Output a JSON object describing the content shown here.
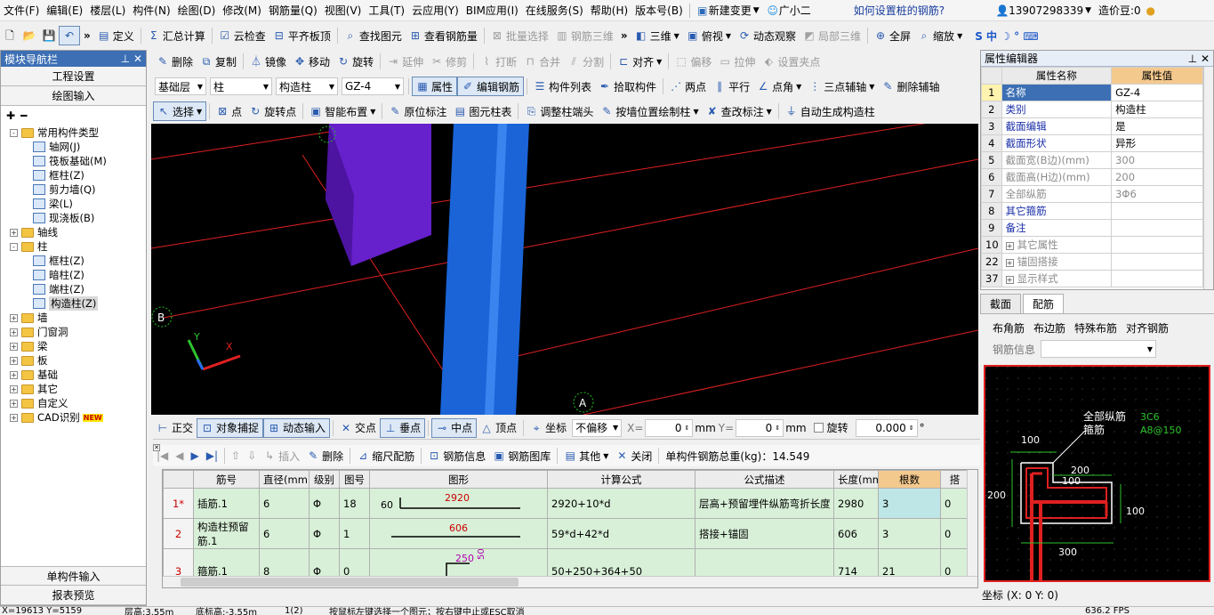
{
  "menu": {
    "items": [
      "文件(F)",
      "编辑(E)",
      "楼层(L)",
      "构件(N)",
      "绘图(D)",
      "修改(M)",
      "钢筋量(Q)",
      "视图(V)",
      "工具(T)",
      "云应用(Y)",
      "BIM应用(I)",
      "在线服务(S)",
      "帮助(H)",
      "版本号(B)"
    ],
    "new_change": "新建变更",
    "guangxiaoer": "广小二",
    "question": "如何设置桩的钢筋?",
    "phone": "13907298339",
    "coins": "造价豆:0"
  },
  "toolbar1": {
    "items": [
      "定义",
      "汇总计算",
      "云检查",
      "平齐板顶",
      "查找图元",
      "查看钢筋量",
      "批量选择",
      "钢筋三维"
    ],
    "right_items": [
      "三维",
      "俯视",
      "动态观察",
      "局部三维",
      "全屏",
      "缩放"
    ]
  },
  "toolbar2": {
    "items": [
      "删除",
      "复制",
      "镜像",
      "移动",
      "旋转",
      "延伸",
      "修剪",
      "打断",
      "合并",
      "分割",
      "对齐",
      "偏移",
      "拉伸",
      "设置夹点"
    ]
  },
  "toolbar3": {
    "floor": "基础层",
    "category": "柱",
    "type": "构造柱",
    "name": "GZ-4",
    "items": [
      "属性",
      "编辑钢筋",
      "构件列表",
      "拾取构件",
      "两点",
      "平行",
      "点角",
      "三点辅轴",
      "删除辅轴"
    ]
  },
  "toolbar4": {
    "items": [
      "选择",
      "点",
      "旋转点",
      "智能布置",
      "原位标注",
      "图元柱表",
      "调整柱端头",
      "按墙位置绘制柱",
      "查改标注",
      "自动生成构造柱"
    ]
  },
  "nav": {
    "title": "模块导航栏",
    "project_settings": "工程设置",
    "drawing_input": "绘图输入",
    "single_input": "单构件输入",
    "report_preview": "报表预览",
    "tree": [
      {
        "level": 0,
        "exp": "-",
        "icon": "folder",
        "label": "常用构件类型"
      },
      {
        "level": 1,
        "icon": "comp",
        "label": "轴网(J)"
      },
      {
        "level": 1,
        "icon": "comp",
        "label": "筏板基础(M)"
      },
      {
        "level": 1,
        "icon": "comp",
        "label": "框柱(Z)"
      },
      {
        "level": 1,
        "icon": "comp",
        "label": "剪力墙(Q)"
      },
      {
        "level": 1,
        "icon": "comp",
        "label": "梁(L)"
      },
      {
        "level": 1,
        "icon": "comp",
        "label": "现浇板(B)"
      },
      {
        "level": 0,
        "exp": "+",
        "icon": "folder",
        "label": "轴线"
      },
      {
        "level": 0,
        "exp": "-",
        "icon": "folder",
        "label": "柱"
      },
      {
        "level": 1,
        "icon": "comp",
        "label": "框柱(Z)"
      },
      {
        "level": 1,
        "icon": "comp",
        "label": "暗柱(Z)"
      },
      {
        "level": 1,
        "icon": "comp",
        "label": "端柱(Z)"
      },
      {
        "level": 1,
        "icon": "comp",
        "label": "构造柱(Z)",
        "selected": true
      },
      {
        "level": 0,
        "exp": "+",
        "icon": "folder",
        "label": "墙"
      },
      {
        "level": 0,
        "exp": "+",
        "icon": "folder",
        "label": "门窗洞"
      },
      {
        "level": 0,
        "exp": "+",
        "icon": "folder",
        "label": "梁"
      },
      {
        "level": 0,
        "exp": "+",
        "icon": "folder",
        "label": "板"
      },
      {
        "level": 0,
        "exp": "+",
        "icon": "folder",
        "label": "基础"
      },
      {
        "level": 0,
        "exp": "+",
        "icon": "folder",
        "label": "其它"
      },
      {
        "level": 0,
        "exp": "+",
        "icon": "folder",
        "label": "自定义"
      },
      {
        "level": 0,
        "exp": "+",
        "icon": "folder",
        "label": "CAD识别",
        "badge": "NEW"
      }
    ]
  },
  "viewport": {
    "axis_b": "B",
    "axis_a": "A",
    "axis_y": "Y",
    "axis_x": "X"
  },
  "snapbar": {
    "items": [
      "正交",
      "对象捕捉",
      "动态输入",
      "交点",
      "垂点",
      "中点",
      "顶点",
      "坐标"
    ],
    "offset_mode": "不偏移",
    "x_label": "X=",
    "x_value": "0",
    "y_label": "Y=",
    "y_value": "0",
    "unit": "mm",
    "rotate_label": "旋转",
    "rotate_value": "0.000",
    "degree": "°"
  },
  "rebarbar": {
    "items": [
      "插入",
      "删除",
      "缩尺配筋",
      "钢筋信息",
      "钢筋图库",
      "其他",
      "关闭"
    ],
    "total": "单构件钢筋总重(kg)：14.549"
  },
  "rebar_table": {
    "headers": [
      "",
      "筋号",
      "直径(mm)",
      "级别",
      "图号",
      "图形",
      "计算公式",
      "公式描述",
      "长度(mm)",
      "根数",
      "搭"
    ],
    "rows": [
      {
        "no": "1*",
        "name": "插筋.1",
        "dia": "6",
        "grade": "Φ",
        "fig": "18",
        "left": "60",
        "shape": "2920",
        "formula": "2920+10*d",
        "desc": "层高+预留埋件纵筋弯折长度",
        "len": "2980",
        "count": "3",
        "lap": "0"
      },
      {
        "no": "2",
        "name": "构造柱预留筋.1",
        "dia": "6",
        "grade": "Φ",
        "fig": "1",
        "left": "",
        "shape": "606",
        "formula": "59*d+42*d",
        "desc": "搭接+锚固",
        "len": "606",
        "count": "3",
        "lap": "0"
      },
      {
        "no": "3",
        "name": "箍筋.1",
        "dia": "8",
        "grade": "Φ",
        "fig": "0",
        "left": "",
        "shape": "250",
        "shape2": "50",
        "shape3": "364",
        "formula": "50+250+364+50",
        "desc": "",
        "len": "714",
        "count": "21",
        "lap": "0"
      }
    ]
  },
  "prop": {
    "title": "属性编辑器",
    "col_name": "属性名称",
    "col_value": "属性值",
    "rows": [
      {
        "n": "1",
        "name": "名称",
        "value": "GZ-4",
        "style": "blue",
        "sel": true
      },
      {
        "n": "2",
        "name": "类别",
        "value": "构造柱",
        "style": "blue"
      },
      {
        "n": "3",
        "name": "截面编辑",
        "value": "是",
        "style": "blue"
      },
      {
        "n": "4",
        "name": "截面形状",
        "value": "异形",
        "style": "blue"
      },
      {
        "n": "5",
        "name": "截面宽(B边)(mm)",
        "value": "300",
        "style": "grey"
      },
      {
        "n": "6",
        "name": "截面高(H边)(mm)",
        "value": "200",
        "style": "grey"
      },
      {
        "n": "7",
        "name": "全部纵筋",
        "value": "3Φ6",
        "style": "grey"
      },
      {
        "n": "8",
        "name": "其它箍筋",
        "value": "",
        "style": "blue"
      },
      {
        "n": "9",
        "name": "备注",
        "value": "",
        "style": "blue"
      },
      {
        "n": "10",
        "name": "其它属性",
        "value": "",
        "style": "grey",
        "exp": "+"
      },
      {
        "n": "22",
        "name": "锚固搭接",
        "value": "",
        "style": "grey",
        "exp": "+"
      },
      {
        "n": "37",
        "name": "显示样式",
        "value": "",
        "style": "grey",
        "exp": "+"
      }
    ]
  },
  "section": {
    "tab_section": "截面",
    "tab_rebar": "配筋",
    "buttons": [
      "布角筋",
      "布边筋",
      "特殊布筋",
      "对齐钢筋"
    ],
    "rebar_info": "钢筋信息",
    "label_all": "全部纵筋",
    "label_stirrup": "箍筋",
    "val_all": "3C6",
    "val_stirrup": "A8@150",
    "dim_100a": "100",
    "dim_200a": "200",
    "dim_100b": "100",
    "dim_200b": "200",
    "dim_100c": "100",
    "dim_300": "300",
    "coord": "坐标 (X: 0 Y: 0)"
  },
  "status": {
    "left": "X=19613 Y=5159",
    "floor_h": "层高:3.55m",
    "bottom_h": "底标高:-3.55m",
    "page": "1(2)",
    "hint": "按鼠标左键选择一个图元；按右键中止或ESC取消",
    "fps": "636.2 FPS"
  }
}
